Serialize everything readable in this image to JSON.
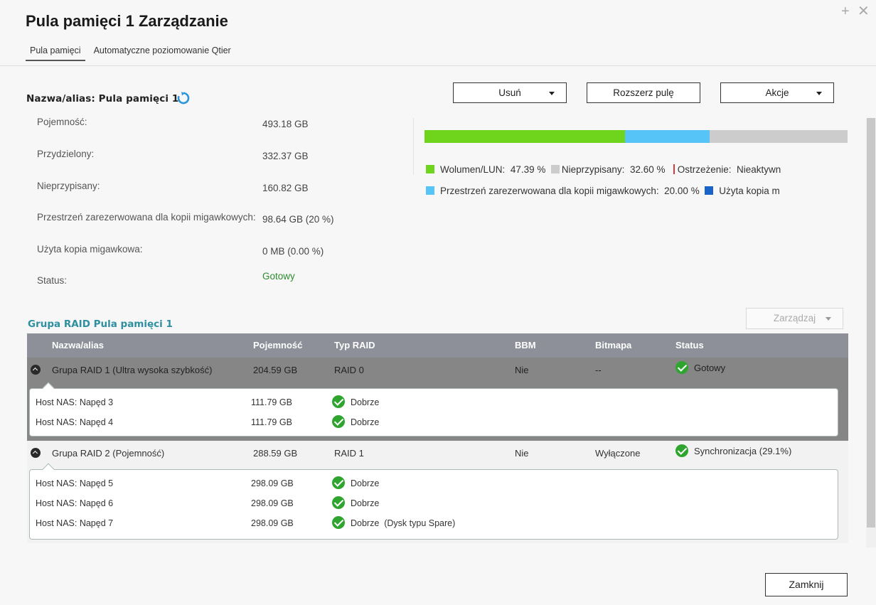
{
  "window": {
    "title": "Pula pamięci 1 Zarządzanie",
    "plus_glyph": "+",
    "close_glyph": "✕"
  },
  "tabs": [
    {
      "label": "Pula pamięci",
      "active": true
    },
    {
      "label": "Automatyczne poziomowanie Qtier",
      "active": false
    }
  ],
  "pool": {
    "name_label": "Nazwa/alias: Pula pamięci 1"
  },
  "buttons": {
    "delete": "Usuń",
    "expand": "Rozszerz pulę",
    "actions": "Akcje",
    "manage": "Zarządzaj",
    "close": "Zamknij"
  },
  "info": {
    "capacity": {
      "label": "Pojemność:",
      "value": "493.18 GB"
    },
    "allocated": {
      "label": "Przydzielony:",
      "value": "332.37 GB"
    },
    "unallocated": {
      "label": "Nieprzypisany:",
      "value": "160.82 GB"
    },
    "snapshot_reserved": {
      "label": "Przestrzeń zarezerwowana dla kopii migawkowych:",
      "value": "98.64 GB (20 %)"
    },
    "snapshot_used": {
      "label": "Użyta kopia migawkowa:",
      "value": "0 MB (0.00 %)"
    },
    "status": {
      "label": "Status:",
      "value": "Gotowy"
    }
  },
  "usage_bar": {
    "segments": [
      {
        "name": "volume",
        "percent": 47.39,
        "color": "#6fd41c"
      },
      {
        "name": "snapshot",
        "percent": 20.0,
        "color": "#56c4f6"
      },
      {
        "name": "unallocated",
        "percent": 32.6,
        "color": "#cccccc"
      }
    ]
  },
  "legend": {
    "volume": {
      "label": "Wolumen/LUN:",
      "value": "47.39 %",
      "color": "#6fd41c"
    },
    "unallocated": {
      "label": "Nieprzypisany:",
      "value": "32.60 %",
      "color": "#cccccc"
    },
    "warning": {
      "label": "Ostrzeżenie:",
      "value": "Nieaktywn",
      "color": "#d93a3a"
    },
    "snapshot_reserved": {
      "label": "Przestrzeń zarezerwowana dla kopii migawkowych:",
      "value": "20.00 %",
      "color": "#56c4f6"
    },
    "snapshot_used": {
      "label": "Użyta kopia m",
      "color": "#1a64c8"
    }
  },
  "raid_section": {
    "title": "Grupa RAID Pula pamięci 1"
  },
  "table": {
    "headers": {
      "name": "Nazwa/alias",
      "capacity": "Pojemność",
      "raid_type": "Typ RAID",
      "bbm": "BBM",
      "bitmap": "Bitmapa",
      "status": "Status"
    },
    "groups": [
      {
        "name": "Grupa RAID 1 (Ultra wysoka szybkość)",
        "capacity": "204.59 GB",
        "raid_type": "RAID 0",
        "bbm": "Nie",
        "bitmap": "--",
        "status": "Gotowy",
        "drives": [
          {
            "name": "Host NAS: Napęd 3",
            "capacity": "111.79 GB",
            "status": "Dobrze"
          },
          {
            "name": "Host NAS: Napęd 4",
            "capacity": "111.79 GB",
            "status": "Dobrze"
          }
        ]
      },
      {
        "name": "Grupa RAID 2 (Pojemność)",
        "capacity": "288.59 GB",
        "raid_type": "RAID 1",
        "bbm": "Nie",
        "bitmap": "Wyłączone",
        "status": "Synchronizacja (29.1%)",
        "drives": [
          {
            "name": "Host NAS: Napęd 5",
            "capacity": "298.09 GB",
            "status": "Dobrze"
          },
          {
            "name": "Host NAS: Napęd 6",
            "capacity": "298.09 GB",
            "status": "Dobrze"
          },
          {
            "name": "Host NAS: Napęd 7",
            "capacity": "298.09 GB",
            "status": "Dobrze  (Dysk typu Spare)"
          }
        ]
      }
    ]
  }
}
